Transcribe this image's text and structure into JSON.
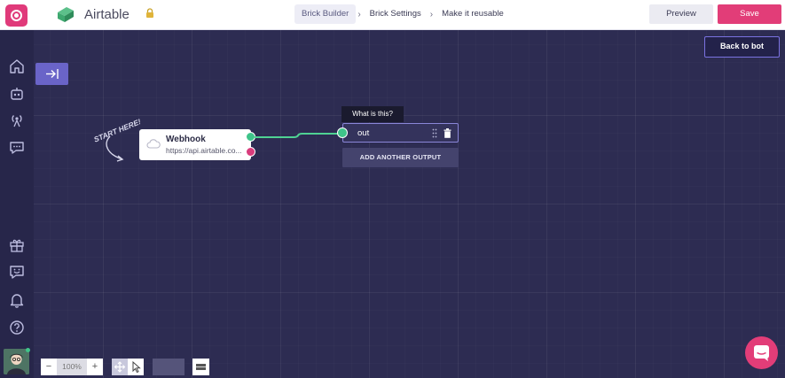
{
  "header": {
    "app_title": "Airtable",
    "breadcrumbs": [
      {
        "label": "Brick Builder",
        "active": true
      },
      {
        "label": "Brick Settings",
        "active": false
      },
      {
        "label": "Make it reusable",
        "active": false
      }
    ],
    "separator": "›",
    "preview_label": "Preview",
    "save_label": "Save"
  },
  "sidebar": {
    "top_icons": [
      "home-icon",
      "bot-icon",
      "broadcast-icon",
      "chat-icon"
    ],
    "bottom_icons": [
      "gift-icon",
      "feedback-icon",
      "bell-icon",
      "help-icon"
    ]
  },
  "canvas": {
    "back_label": "Back to bot",
    "start_note": "START HERE!",
    "webhook": {
      "title": "Webhook",
      "url": "https://api.airtable.co..."
    },
    "tooltip": "What is this?",
    "output": {
      "label": "out"
    },
    "add_output_label": "ADD ANOTHER OUTPUT"
  },
  "zoom": {
    "minus": "−",
    "value": "100%",
    "plus": "+"
  },
  "colors": {
    "accent": "#e23d78",
    "canvas": "#2d2c52",
    "success": "#3fc48a",
    "primary": "#6a64c8"
  }
}
